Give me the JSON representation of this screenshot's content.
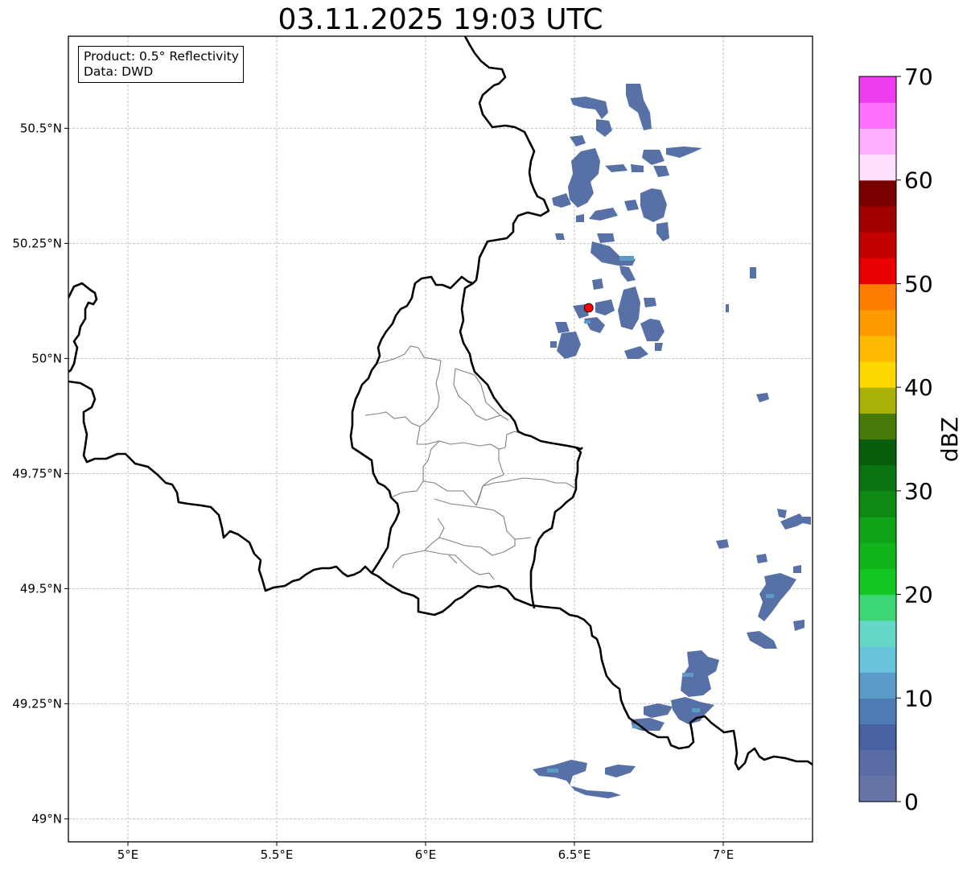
{
  "title": "03.11.2025 19:03 UTC",
  "info": {
    "product": "Product: 0.5° Reflectivity",
    "data": "Data: DWD"
  },
  "map": {
    "lon_range": [
      4.8,
      7.3
    ],
    "lat_range": [
      48.95,
      50.7
    ],
    "grid": true,
    "x_ticks": [
      {
        "value": 5.0,
        "label": "5°E"
      },
      {
        "value": 5.5,
        "label": "5.5°E"
      },
      {
        "value": 6.0,
        "label": "6°E"
      },
      {
        "value": 6.5,
        "label": "6.5°E"
      },
      {
        "value": 7.0,
        "label": "7°E"
      }
    ],
    "y_ticks": [
      {
        "value": 50.5,
        "label": "50.5°N"
      },
      {
        "value": 50.25,
        "label": "50.25°N"
      },
      {
        "value": 50.0,
        "label": "50°N"
      },
      {
        "value": 49.75,
        "label": "49.75°N"
      },
      {
        "value": 49.5,
        "label": "49.5°N"
      },
      {
        "value": 49.25,
        "label": "49.25°N"
      },
      {
        "value": 49.0,
        "label": "49°N"
      }
    ],
    "radar_site": {
      "lon": 6.548,
      "lat": 50.11,
      "color": "#ff0000"
    },
    "border_color": "#000000",
    "district_color": "#808080"
  },
  "colorbar": {
    "label": "dBZ",
    "min": 0,
    "max": 70,
    "ticks": [
      {
        "value": 0,
        "label": "0"
      },
      {
        "value": 10,
        "label": "10"
      },
      {
        "value": 20,
        "label": "20"
      },
      {
        "value": 30,
        "label": "30"
      },
      {
        "value": 40,
        "label": "40"
      },
      {
        "value": 50,
        "label": "50"
      },
      {
        "value": 60,
        "label": "60"
      },
      {
        "value": 70,
        "label": "70"
      }
    ],
    "colors": [
      "#6575a8",
      "#5a6ca4",
      "#4a62a3",
      "#4f7cb4",
      "#5b9bc8",
      "#68c3dc",
      "#66d8c8",
      "#3cd676",
      "#12c722",
      "#11b51b",
      "#10a318",
      "#0e8a14",
      "#0b7410",
      "#085d0d",
      "#487a0a",
      "#aab00a",
      "#ffd800",
      "#ffb900",
      "#ff9900",
      "#ff7e00",
      "#e80000",
      "#c20000",
      "#a00000",
      "#7a0000",
      "#ffe0ff",
      "#ffb0ff",
      "#ff70ff",
      "#ee3cee"
    ]
  },
  "echo_colors": [
    "#4f6aa3",
    "#4a62a3",
    "#5b7fb5",
    "#5a9bc9"
  ]
}
